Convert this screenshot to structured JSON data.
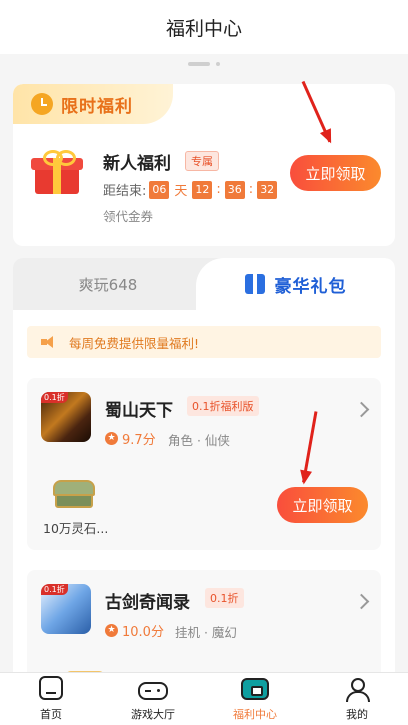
{
  "header": {
    "title": "福利中心"
  },
  "limited": {
    "tag": "限时福利",
    "title": "新人福利",
    "badge": "专属",
    "countdown_label": "距结束:",
    "days": "06",
    "day_unit": "天",
    "hours": "12",
    "minutes": "36",
    "seconds": "32",
    "subtitle": "领代金券",
    "button": "立即领取"
  },
  "tabs": {
    "left": "爽玩648",
    "right": "豪华礼包"
  },
  "notice": "每周免费提供限量福利!",
  "games": [
    {
      "icon_tag": "0.1折",
      "name": "蜀山天下",
      "badge": "0.1折福利版",
      "rating": "9.7分",
      "category": "角色 · 仙侠",
      "item": "10万灵石...",
      "button": "立即领取"
    },
    {
      "icon_tag": "0.1折",
      "name": "古剑奇闻录",
      "badge": "0.1折",
      "rating": "10.0分",
      "category": "挂机 · 魔幻"
    }
  ],
  "tabbar": [
    {
      "label": "首页",
      "icon": "home-icon"
    },
    {
      "label": "游戏大厅",
      "icon": "gamepad-icon"
    },
    {
      "label": "福利中心",
      "icon": "welfare-icon"
    },
    {
      "label": "我的",
      "icon": "user-icon"
    }
  ],
  "colors": {
    "accent": "#f07a3a",
    "button_start": "#f94e3c",
    "button_end": "#fb8a2d",
    "tab_blue": "#1f5fd6"
  }
}
